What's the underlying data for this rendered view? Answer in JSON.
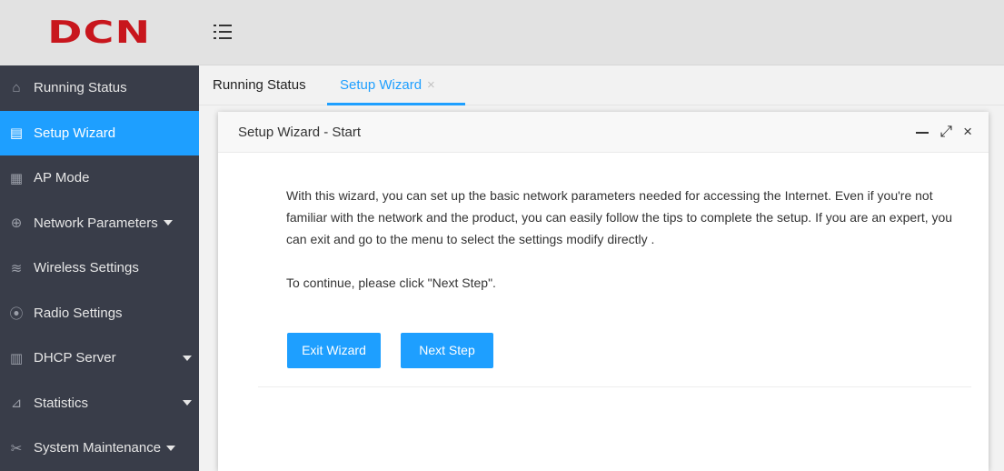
{
  "brand": {
    "logo_text": "DCN",
    "logo_color": "#c8161d"
  },
  "sidebar": {
    "items": [
      {
        "label": "Running Status",
        "icon": "home-icon",
        "glyph": "⌂"
      },
      {
        "label": "Setup Wizard",
        "icon": "setup-wizard-icon",
        "glyph": "▤",
        "active": true
      },
      {
        "label": "AP Mode",
        "icon": "ap-mode-icon",
        "glyph": "▦"
      },
      {
        "label": "Network Parameters",
        "icon": "globe-icon",
        "glyph": "⊕"
      },
      {
        "label": "Wireless Settings",
        "icon": "wifi-icon",
        "glyph": "≋"
      },
      {
        "label": "Radio Settings",
        "icon": "radio-icon",
        "glyph": "⦿"
      },
      {
        "label": "DHCP Server",
        "icon": "server-icon",
        "glyph": "▥"
      },
      {
        "label": "Statistics",
        "icon": "chart-icon",
        "glyph": "⊿"
      },
      {
        "label": "System Maintenance",
        "icon": "tools-icon",
        "glyph": "✂"
      }
    ]
  },
  "tabs": [
    {
      "label": "Running Status"
    },
    {
      "label": "Setup Wizard",
      "close": "×"
    }
  ],
  "modal": {
    "title": "Setup Wizard - Start",
    "controls": {
      "maximize": "⤢",
      "close": "×"
    },
    "paragraph1": "With this wizard, you can set up the basic network parameters needed for accessing the Internet. Even if you're not familiar with the network and the product, you can easily follow the tips to complete the setup. If you are an expert, you can exit and go to the menu to select the settings modify directly .",
    "paragraph2": "To continue, please click \"Next Step\".",
    "exit_label": "Exit Wizard",
    "next_label": "Next Step"
  },
  "colors": {
    "accent": "#1e9fff",
    "sidebar_bg": "#393d49",
    "header_bg": "#e2e2e2"
  }
}
